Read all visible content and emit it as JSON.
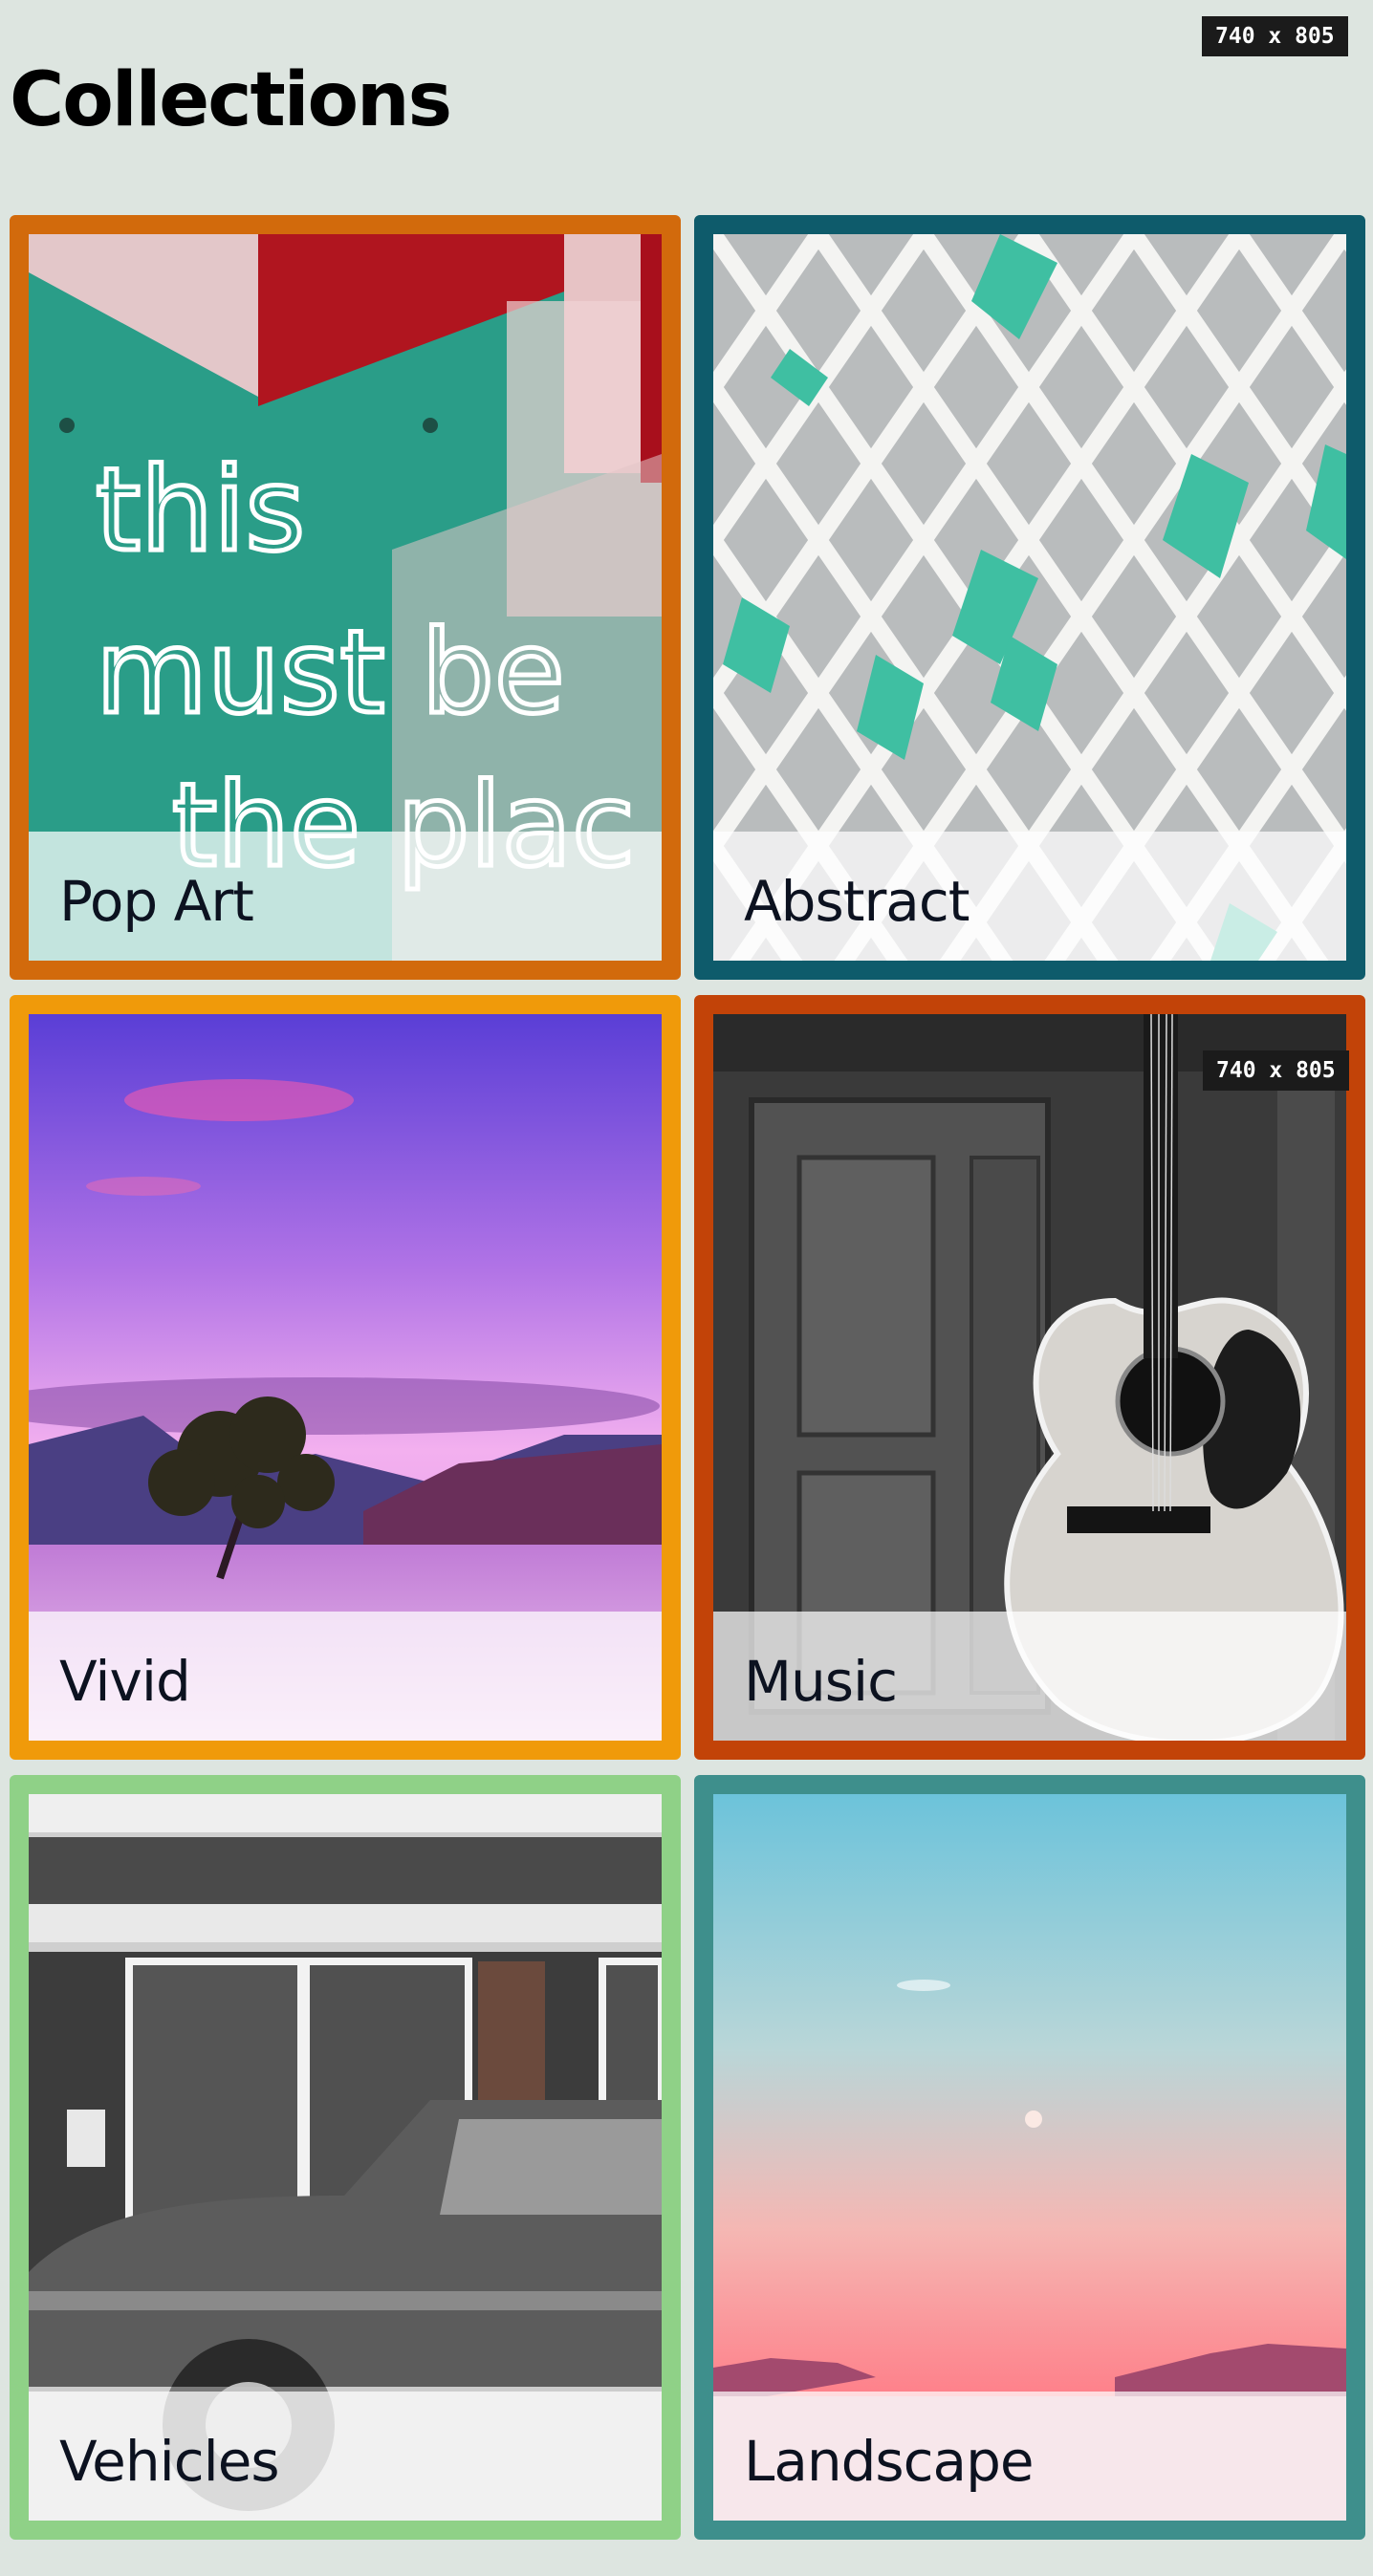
{
  "page": {
    "title": "Collections"
  },
  "badges": {
    "top": "740 x 805",
    "card": "740 x 805"
  },
  "cards": [
    {
      "label": "Pop Art",
      "border_color": "#d26a0c",
      "image": "neon-sign-this-must-be-the-place"
    },
    {
      "label": "Abstract",
      "border_color": "#0e5b6b",
      "image": "white-lattice-facade"
    },
    {
      "label": "Vivid",
      "border_color": "#f09a0a",
      "image": "purple-lake-tree-sunset"
    },
    {
      "label": "Music",
      "border_color": "#c24308",
      "image": "acoustic-guitar-against-door"
    },
    {
      "label": "Vehicles",
      "border_color": "#8fd187",
      "image": "vintage-car-storefront"
    },
    {
      "label": "Landscape",
      "border_color": "#3e8f8c",
      "image": "pastel-sky-mountains"
    }
  ],
  "neon_text": [
    "this",
    "must be",
    "the plac"
  ]
}
